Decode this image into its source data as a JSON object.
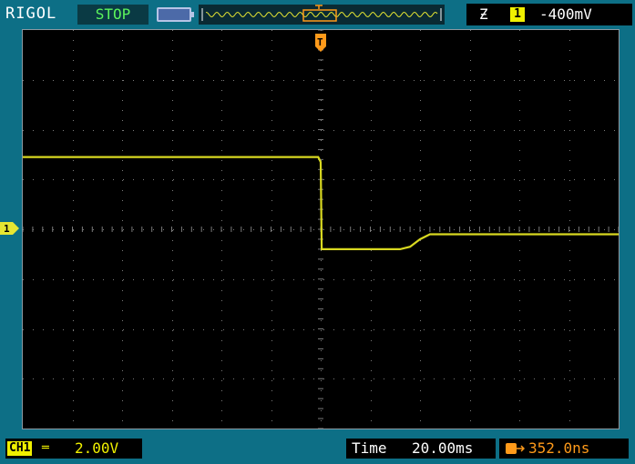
{
  "header": {
    "brand": "RIGOL",
    "status": "STOP",
    "trigger_edge": "Ƶ",
    "trigger_channel": "1",
    "trigger_level": "-400mV"
  },
  "channel": {
    "tag": "CH1",
    "coupling": "═",
    "scale": "2.00V",
    "marker": "1",
    "color": "#e6e632"
  },
  "timebase": {
    "label": "Time",
    "value": "20.00ms",
    "trigger_position": "352.0ns"
  },
  "trigger_marker": "T",
  "colors": {
    "background": "#0d6f86",
    "grid": "#7a7a7a",
    "trace": "#d8d820",
    "trigger": "#ff9a1a",
    "status": "#5cf55c"
  },
  "chart_data": {
    "type": "line",
    "title": "",
    "xlabel": "",
    "ylabel": "",
    "grid": true,
    "xdiv": 12,
    "ydiv": 8,
    "x_units": "divisions",
    "y_units": "divisions",
    "xlim": [
      -6,
      6
    ],
    "ylim": [
      -4,
      4
    ],
    "series": [
      {
        "x": [
          -6.0,
          -0.05,
          0.0,
          0.02,
          1.6,
          1.8,
          2.0,
          2.2,
          6.0
        ],
        "y": [
          1.45,
          1.45,
          1.35,
          -0.4,
          -0.4,
          -0.35,
          -0.2,
          -0.1,
          -0.1
        ]
      }
    ]
  }
}
